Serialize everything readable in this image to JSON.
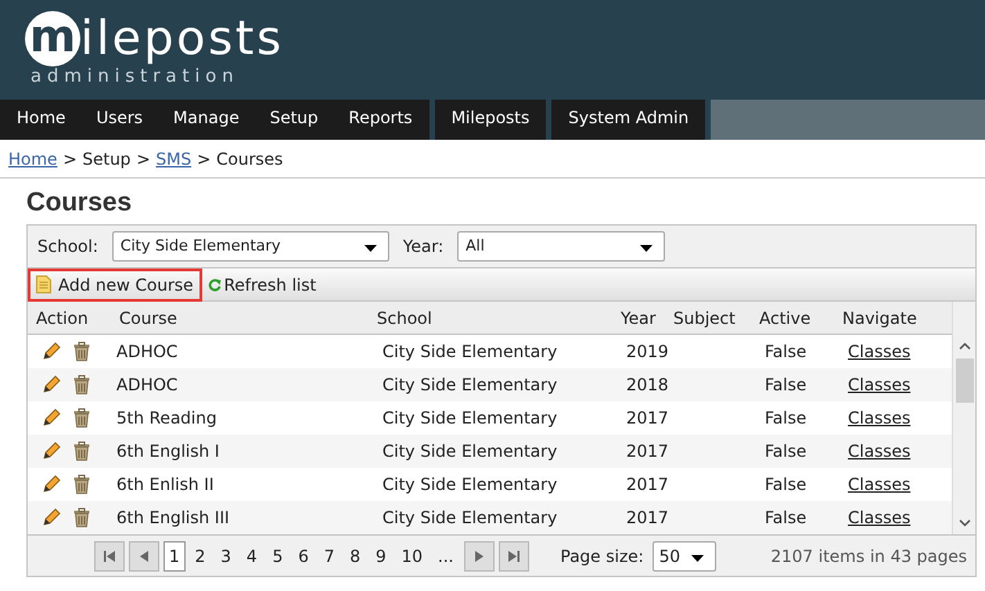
{
  "logo": {
    "letter": "m",
    "name": "ileposts",
    "subtitle": "administration"
  },
  "nav": {
    "groups": [
      [
        "Home",
        "Users",
        "Manage",
        "Setup",
        "Reports"
      ],
      [
        "Mileposts"
      ],
      [
        "System Admin"
      ]
    ]
  },
  "breadcrumb": [
    {
      "label": "Home",
      "link": true
    },
    {
      "label": "Setup",
      "link": false
    },
    {
      "label": "SMS",
      "link": true
    },
    {
      "label": "Courses",
      "link": false
    }
  ],
  "breadcrumb_separator": ">",
  "title": "Courses",
  "filters": [
    {
      "label": "School:",
      "value": "City Side Elementary"
    },
    {
      "label": "Year:",
      "value": "All"
    }
  ],
  "toolbar": {
    "add": "Add new Course",
    "refresh": "Refresh list"
  },
  "table": {
    "columns": [
      "Action",
      "Course",
      "School",
      "Year",
      "Subject",
      "Active",
      "Navigate"
    ],
    "rows": [
      {
        "course": "ADHOC",
        "school": "City Side Elementary",
        "year": "2019",
        "subject": "",
        "active": "False",
        "navigate": "Classes"
      },
      {
        "course": "ADHOC",
        "school": "City Side Elementary",
        "year": "2018",
        "subject": "",
        "active": "False",
        "navigate": "Classes"
      },
      {
        "course": "5th Reading",
        "school": "City Side Elementary",
        "year": "2017",
        "subject": "",
        "active": "False",
        "navigate": "Classes"
      },
      {
        "course": "6th English I",
        "school": "City Side Elementary",
        "year": "2017",
        "subject": "",
        "active": "False",
        "navigate": "Classes"
      },
      {
        "course": "6th Enlish II",
        "school": "City Side Elementary",
        "year": "2017",
        "subject": "",
        "active": "False",
        "navigate": "Classes"
      },
      {
        "course": "6th English III",
        "school": "City Side Elementary",
        "year": "2017",
        "subject": "",
        "active": "False",
        "navigate": "Classes"
      }
    ]
  },
  "pager": {
    "pages": [
      {
        "label": "1",
        "selected": true
      },
      {
        "label": "2",
        "selected": false
      },
      {
        "label": "3",
        "selected": false
      },
      {
        "label": "4",
        "selected": false
      },
      {
        "label": "5",
        "selected": false
      },
      {
        "label": "6",
        "selected": false
      },
      {
        "label": "7",
        "selected": false
      },
      {
        "label": "8",
        "selected": false
      },
      {
        "label": "9",
        "selected": false
      },
      {
        "label": "10",
        "selected": false
      },
      {
        "label": "...",
        "selected": false
      }
    ],
    "page_size_label": "Page size:",
    "page_size": "50",
    "summary": "2107 items in 43 pages"
  }
}
